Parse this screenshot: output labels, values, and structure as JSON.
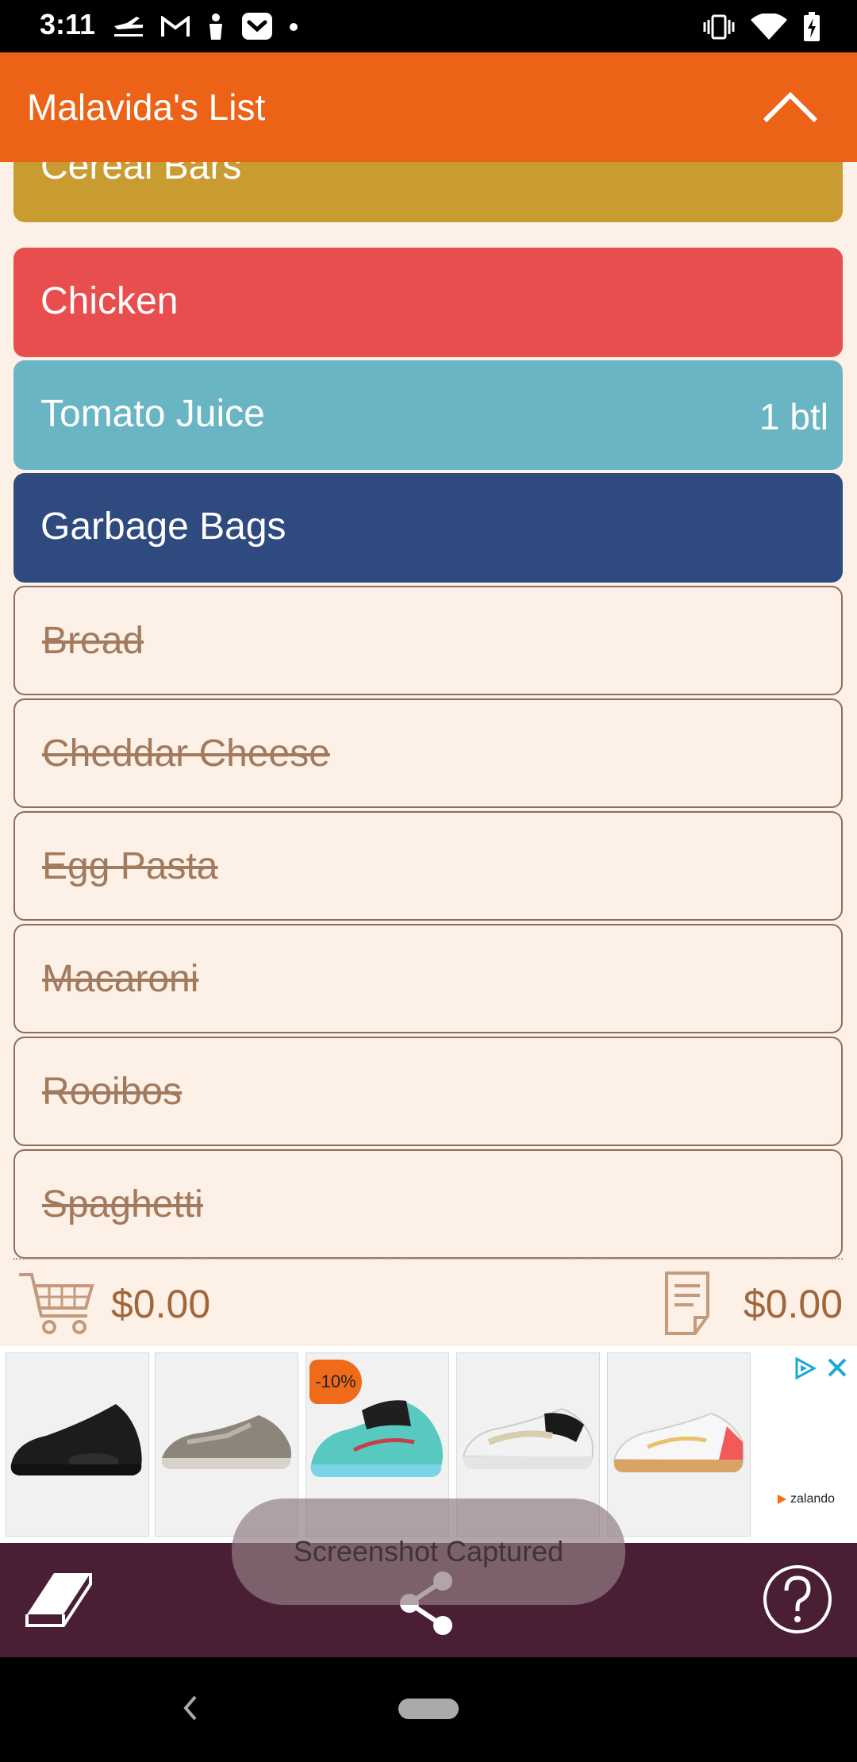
{
  "status_bar": {
    "time": "3:11",
    "left_icons": [
      "airplane-notification-icon",
      "gmail-icon",
      "person-icon",
      "pocket-icon",
      "dot-icon"
    ],
    "right_icons": [
      "vibrate-icon",
      "wifi-icon",
      "battery-charging-icon"
    ]
  },
  "app_bar": {
    "title": "Malavida's List",
    "collapse_icon": "chevron-up-icon"
  },
  "list": {
    "items": [
      {
        "label": "Cereal Bars",
        "quantity": "",
        "checked": false,
        "color": "#c99c31"
      },
      {
        "label": "Chicken",
        "quantity": "",
        "checked": false,
        "color": "#e84e4e"
      },
      {
        "label": "Tomato Juice",
        "quantity": "1 btl",
        "checked": false,
        "color": "#6ab5c4"
      },
      {
        "label": "Garbage Bags",
        "quantity": "",
        "checked": false,
        "color": "#2f4a7e"
      },
      {
        "label": "Bread",
        "quantity": "",
        "checked": true,
        "color": "#fdf0e6"
      },
      {
        "label": "Cheddar Cheese",
        "quantity": "",
        "checked": true,
        "color": "#fdf0e6"
      },
      {
        "label": "Egg Pasta",
        "quantity": "",
        "checked": true,
        "color": "#fdf0e6"
      },
      {
        "label": "Macaroni",
        "quantity": "",
        "checked": true,
        "color": "#fdf0e6"
      },
      {
        "label": "Rooibos",
        "quantity": "",
        "checked": true,
        "color": "#fdf0e6"
      },
      {
        "label": "Spaghetti",
        "quantity": "",
        "checked": true,
        "color": "#fdf0e6"
      }
    ]
  },
  "totals": {
    "cart_icon": "shopping-cart-icon",
    "cart_total": "$0.00",
    "receipt_icon": "receipt-icon",
    "list_total": "$0.00"
  },
  "ad": {
    "products": [
      {
        "name": "black sneaker",
        "color": "#1c1c1c"
      },
      {
        "name": "grey sneaker",
        "color": "#8c857c"
      },
      {
        "name": "teal sneaker",
        "color": "#58c9c0"
      },
      {
        "name": "white black sneaker",
        "color": "#e9e9e9"
      },
      {
        "name": "white red sneaker",
        "color": "#f4f4f4"
      }
    ],
    "discount_badge": "-10%",
    "brand": "zalando",
    "brand_color": "#ff6900"
  },
  "bottom_bar": {
    "left_icon": "eraser-icon",
    "center_icon": "share-icon",
    "right_icon": "help-icon"
  },
  "toast": {
    "text": "Screenshot Captured"
  },
  "colors": {
    "app_bar": "#ec6217",
    "background": "#fdf0e6",
    "bottom_bar": "#4a1f35",
    "totals_text": "#a0673d"
  }
}
